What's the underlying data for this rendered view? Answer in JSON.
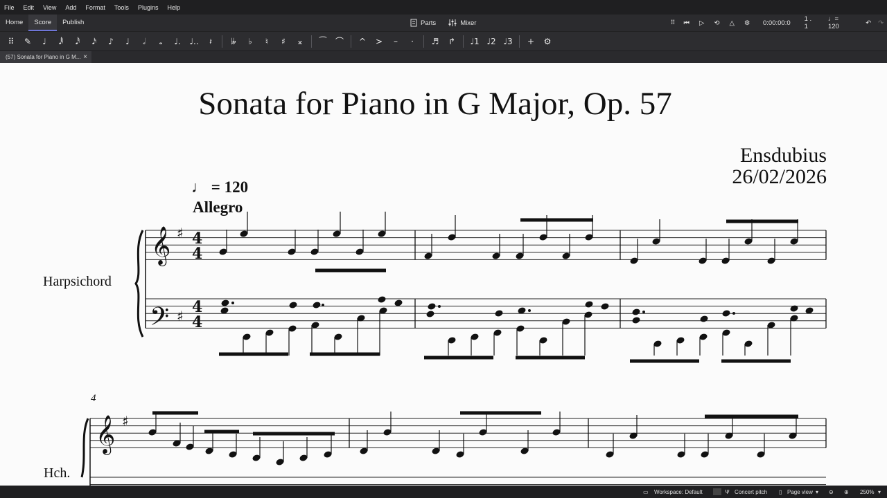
{
  "menu": [
    "File",
    "Edit",
    "View",
    "Add",
    "Format",
    "Tools",
    "Plugins",
    "Help"
  ],
  "tabs": [
    "Home",
    "Score",
    "Publish"
  ],
  "center": {
    "parts": "Parts",
    "mixer": "Mixer"
  },
  "playback": {
    "time": "0:00:00:0",
    "position": "1 . 1",
    "tempo": "♩= 120"
  },
  "document_tab": "(57) Sonata for Piano in G M...",
  "score": {
    "title": "Sonata for Piano in G Major, Op. 57",
    "composer": "Ensdubius",
    "date": "26/02/2026",
    "tempo_mark": "♩ = 120",
    "tempo_text": "Allegro",
    "instrument": "Harpsichord",
    "instrument_short": "Hch.",
    "measure_number": "4",
    "clef_treble": "𝄞",
    "clef_bass": "𝄢",
    "sharp": "♯",
    "time_sig": "4"
  },
  "status": {
    "workspace": "Workspace: Default",
    "concert_pitch": "Concert pitch",
    "view": "Page view",
    "zoom": "250%"
  },
  "colors": {
    "chrome": "#2b2b2e",
    "accent": "#6f76d9",
    "paper": "#fbfbfb"
  }
}
